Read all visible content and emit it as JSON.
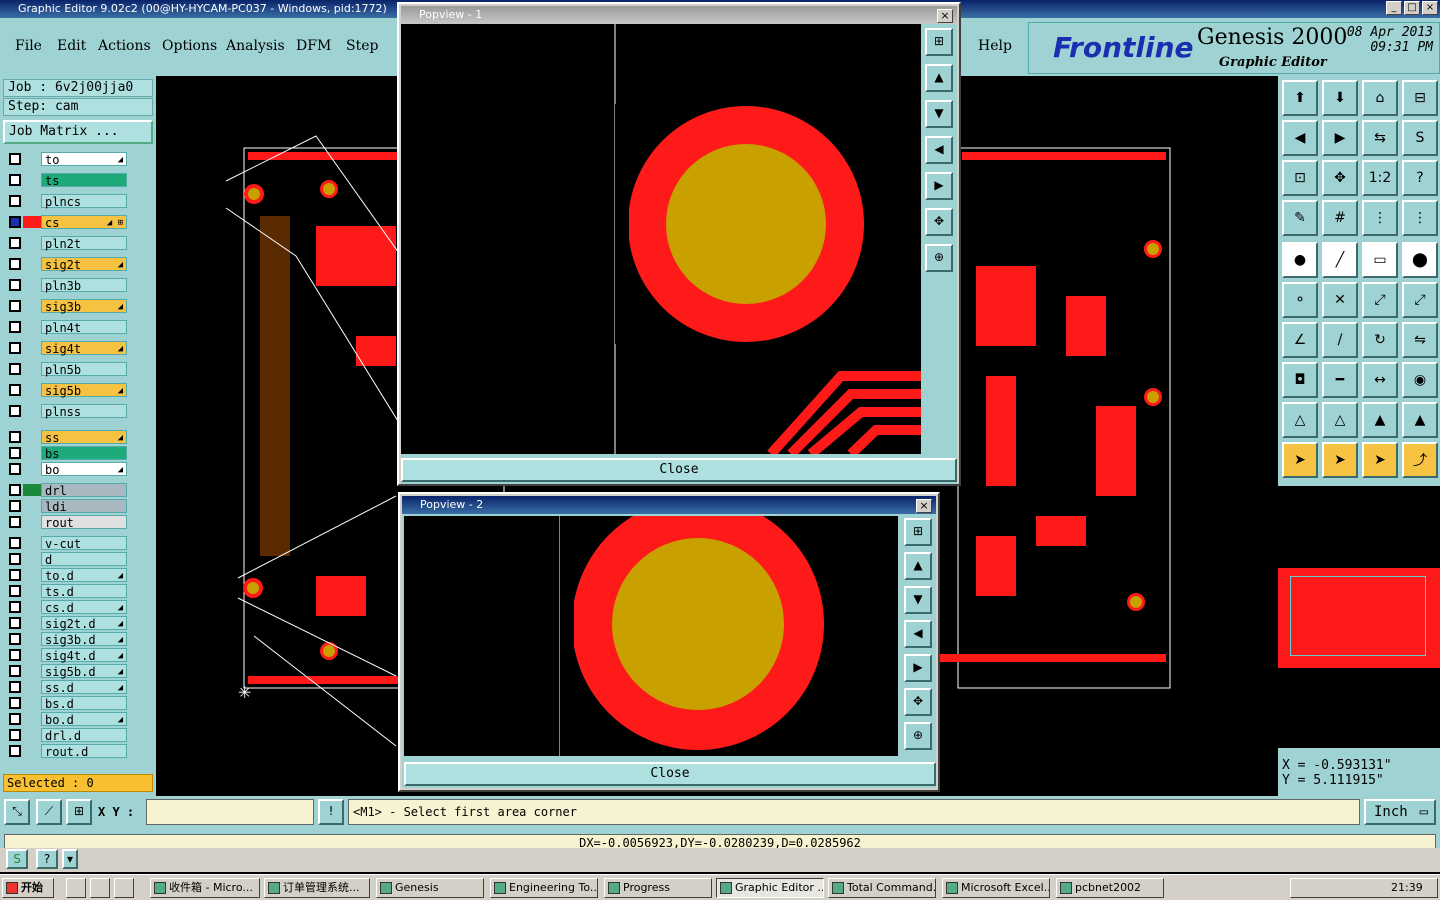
{
  "window": {
    "title": "Graphic Editor 9.02c2 (00@HY-HYCAM-PC037 - Windows, pid:1772)"
  },
  "menu": {
    "items": [
      "File",
      "Edit",
      "Actions",
      "Options",
      "Analysis",
      "DFM",
      "Step",
      "Help"
    ]
  },
  "brand": {
    "logo": "Frontline",
    "product": "Genesis 2000",
    "subtitle": "Graphic Editor",
    "date": "08 Apr 2013",
    "time": "09:31 PM"
  },
  "job": {
    "job_line": "Job : 6v2j00jja0",
    "step_line": "Step: cam",
    "matrix_button": "Job Matrix ..."
  },
  "layers": [
    {
      "name": "to",
      "color": "#ffffff",
      "flag": "◢"
    },
    {
      "name": "ts",
      "color": "#1faa7a",
      "flag": ""
    },
    {
      "name": "plncs",
      "color": "#aee0e0",
      "flag": ""
    },
    {
      "name": "cs",
      "color": "#f5c242",
      "flag": "◢ ⊞"
    },
    {
      "name": "pln2t",
      "color": "#aee0e0",
      "flag": ""
    },
    {
      "name": "sig2t",
      "color": "#f5c242",
      "flag": "◢"
    },
    {
      "name": "pln3b",
      "color": "#aee0e0",
      "flag": ""
    },
    {
      "name": "sig3b",
      "color": "#f5c242",
      "flag": "◢"
    },
    {
      "name": "pln4t",
      "color": "#aee0e0",
      "flag": ""
    },
    {
      "name": "sig4t",
      "color": "#f5c242",
      "flag": "◢"
    },
    {
      "name": "pln5b",
      "color": "#aee0e0",
      "flag": ""
    },
    {
      "name": "sig5b",
      "color": "#f5c242",
      "flag": "◢"
    },
    {
      "name": "plnss",
      "color": "#aee0e0",
      "flag": ""
    },
    {
      "name": "ss",
      "color": "#f5c242",
      "flag": "◢"
    },
    {
      "name": "bs",
      "color": "#1faa7a",
      "flag": ""
    },
    {
      "name": "bo",
      "color": "#ffffff",
      "flag": "◢"
    },
    {
      "name": "drl",
      "color": "#a8b8c0",
      "flag": ""
    },
    {
      "name": "ldi",
      "color": "#a8b8c0",
      "flag": ""
    },
    {
      "name": "rout",
      "color": "#e0e0e0",
      "flag": ""
    },
    {
      "name": "v-cut",
      "color": "#aee0e0",
      "flag": ""
    },
    {
      "name": "d",
      "color": "#aee0e0",
      "flag": ""
    },
    {
      "name": "to.d",
      "color": "#aee0e0",
      "flag": "◢"
    },
    {
      "name": "ts.d",
      "color": "#aee0e0",
      "flag": ""
    },
    {
      "name": "cs.d",
      "color": "#aee0e0",
      "flag": "◢"
    },
    {
      "name": "sig2t.d",
      "color": "#aee0e0",
      "flag": "◢"
    },
    {
      "name": "sig3b.d",
      "color": "#aee0e0",
      "flag": "◢"
    },
    {
      "name": "sig4t.d",
      "color": "#aee0e0",
      "flag": "◢"
    },
    {
      "name": "sig5b.d",
      "color": "#aee0e0",
      "flag": "◢"
    },
    {
      "name": "ss.d",
      "color": "#aee0e0",
      "flag": "◢"
    },
    {
      "name": "bs.d",
      "color": "#aee0e0",
      "flag": ""
    },
    {
      "name": "bo.d",
      "color": "#aee0e0",
      "flag": "◢"
    },
    {
      "name": "drl.d",
      "color": "#aee0e0",
      "flag": ""
    },
    {
      "name": "rout.d",
      "color": "#aee0e0",
      "flag": ""
    }
  ],
  "selected": "Selected : 0",
  "coords": {
    "x": "X = -0.593131\"",
    "y": "Y = 5.111915\""
  },
  "status": {
    "xy_label": "X Y :",
    "xy_value": "",
    "prompt": "<M1> - Select first area corner",
    "units": "Inch"
  },
  "measure": "DX=-0.0056923,DY=-0.0280239,D=0.0285962",
  "popups": [
    {
      "title": "Popview - 1",
      "close": "Close"
    },
    {
      "title": "Popview - 2",
      "close": "Close"
    }
  ],
  "taskbar": {
    "start": "开始",
    "items": [
      "收件箱 - Micro...",
      "订单管理系统...",
      "Genesis",
      "Engineering To...",
      "Progress",
      "Graphic Editor ...",
      "Total Command...",
      "Microsoft Excel...",
      "pcbnet2002"
    ],
    "clock": "21:39"
  },
  "colors": {
    "panel": "#9fd3d3",
    "copper": "#ff1a1a",
    "pad": "#c8a000",
    "title_active": "#0a246a"
  }
}
